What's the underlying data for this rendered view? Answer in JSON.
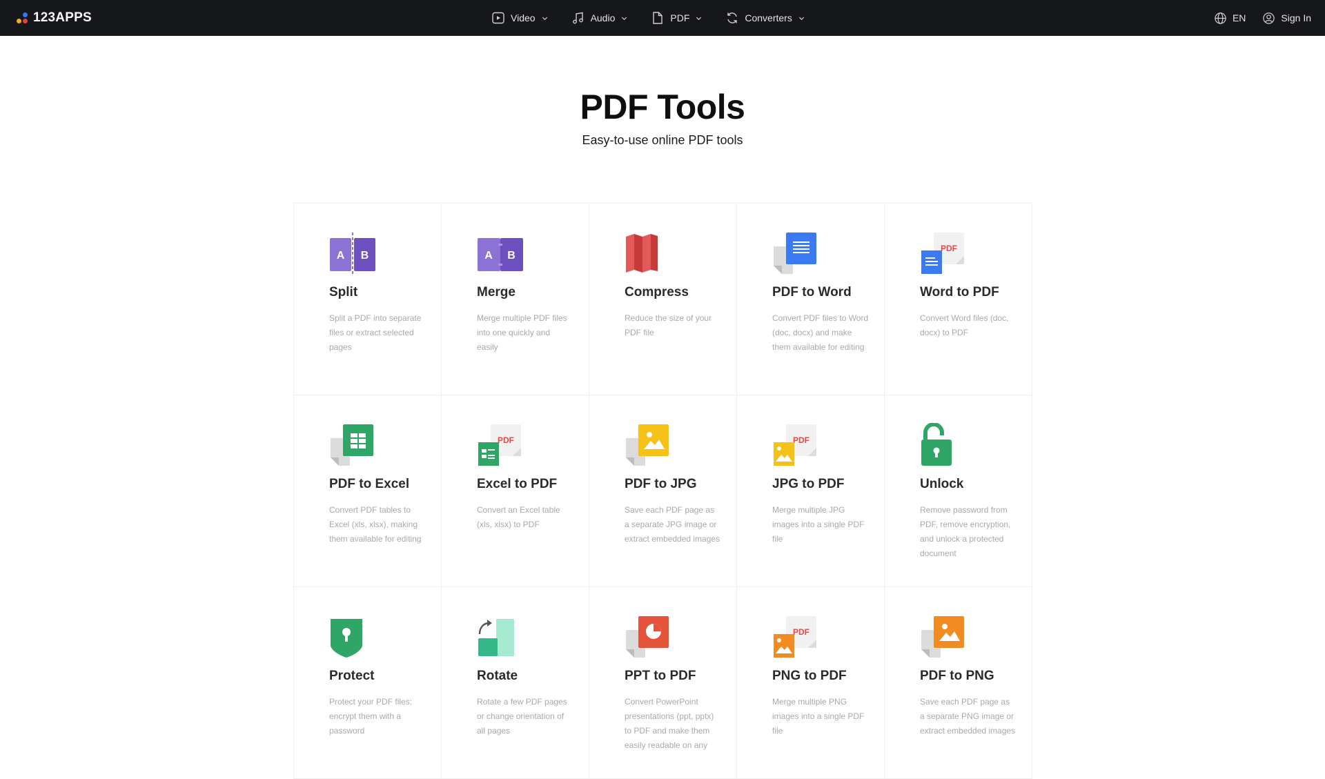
{
  "header": {
    "logo_text": "123APPS",
    "nav": [
      {
        "label": "Video",
        "icon": "video-icon"
      },
      {
        "label": "Audio",
        "icon": "music-note-icon"
      },
      {
        "label": "PDF",
        "icon": "file-icon"
      },
      {
        "label": "Converters",
        "icon": "convert-icon"
      }
    ],
    "language": "EN",
    "sign_in": "Sign In"
  },
  "page": {
    "title": "PDF Tools",
    "subtitle": "Easy-to-use online PDF tools"
  },
  "tools": [
    {
      "title": "Split",
      "desc": "Split a PDF into separate files or extract selected pages",
      "icon": "split-icon"
    },
    {
      "title": "Merge",
      "desc": "Merge multiple PDF files into one quickly and easily",
      "icon": "merge-icon"
    },
    {
      "title": "Compress",
      "desc": "Reduce the size of your PDF file",
      "icon": "compress-icon"
    },
    {
      "title": "PDF to Word",
      "desc": "Convert PDF files to Word (doc, docx) and make them available for editing",
      "icon": "pdf-to-word-icon"
    },
    {
      "title": "Word to PDF",
      "desc": "Convert Word files (doc, docx) to PDF",
      "icon": "word-to-pdf-icon"
    },
    {
      "title": "PDF to Excel",
      "desc": "Convert PDF tables to Excel (xls, xlsx), making them available for editing",
      "icon": "pdf-to-excel-icon"
    },
    {
      "title": "Excel to PDF",
      "desc": "Convert an Excel table (xls, xlsx) to PDF",
      "icon": "excel-to-pdf-icon"
    },
    {
      "title": "PDF to JPG",
      "desc": "Save each PDF page as a separate JPG image or extract embedded images",
      "icon": "pdf-to-jpg-icon"
    },
    {
      "title": "JPG to PDF",
      "desc": "Merge multiple JPG images into a single PDF file",
      "icon": "jpg-to-pdf-icon"
    },
    {
      "title": "Unlock",
      "desc": "Remove password from PDF, remove encryption, and unlock a protected document",
      "icon": "unlock-icon"
    },
    {
      "title": "Protect",
      "desc": "Protect your PDF files: encrypt them with a password",
      "icon": "protect-icon"
    },
    {
      "title": "Rotate",
      "desc": "Rotate a few PDF pages or change orientation of all pages",
      "icon": "rotate-icon"
    },
    {
      "title": "PPT to PDF",
      "desc": "Convert PowerPoint presentations (ppt, pptx) to PDF and make them easily readable on any",
      "icon": "ppt-to-pdf-icon"
    },
    {
      "title": "PNG to PDF",
      "desc": "Merge multiple PNG images into a single PDF file",
      "icon": "png-to-pdf-icon"
    },
    {
      "title": "PDF to PNG",
      "desc": "Save each PDF page as a separate PNG image or extract embedded images",
      "icon": "pdf-to-png-icon"
    }
  ],
  "icon_labels": {
    "split_a": "A",
    "split_b": "B",
    "merge_a": "A",
    "merge_b": "B",
    "pdf": "PDF"
  },
  "colors": {
    "topbar_bg": "#16171b",
    "purple": "#7b5fc9",
    "red": "#e24a4a",
    "blue": "#3a7af2",
    "green": "#2fa566",
    "yellow": "#f6c218",
    "orange": "#f28c22",
    "teal": "#36b88a"
  }
}
